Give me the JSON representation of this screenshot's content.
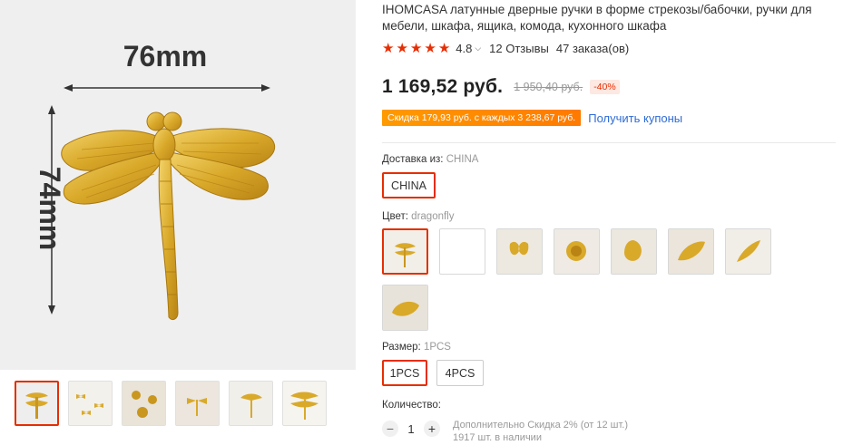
{
  "gallery": {
    "main_image": {
      "dimension_width": "76mm",
      "dimension_height": "74mm"
    },
    "thumbnails": [
      {
        "name": "thumb-1",
        "active": true
      },
      {
        "name": "thumb-2",
        "active": false
      },
      {
        "name": "thumb-3",
        "active": false
      },
      {
        "name": "thumb-4",
        "active": false
      },
      {
        "name": "thumb-5",
        "active": false
      },
      {
        "name": "thumb-6",
        "active": false
      }
    ]
  },
  "product": {
    "title": "IHOMCASA латунные дверные ручки в форме стрекозы/бабочки, ручки для мебели, шкафа, ящика, комода, кухонного шкафа",
    "rating": "4.8",
    "reviews": "12 Отзывы",
    "orders": "47 заказа(ов)",
    "price": "1 169,52 руб.",
    "old_price": "1 950,40 руб.",
    "discount": "-40%",
    "coupon_text": "Скидка 179,93 руб. с каждых 3 238,67 руб.",
    "coupon_link": "Получить купоны"
  },
  "shipping": {
    "label": "Доставка из:",
    "value": "CHINA",
    "option": "CHINA"
  },
  "color": {
    "label": "Цвет:",
    "value": "dragonfly"
  },
  "size": {
    "label": "Размер:",
    "value": "1PCS",
    "options": [
      "1PCS",
      "4PCS"
    ]
  },
  "quantity": {
    "label": "Количество:",
    "minus": "−",
    "value": "1",
    "plus": "+",
    "note_line1": "Дополнительно Скидка 2% (от 12 шт.)",
    "note_line2": "1917 шт. в наличии"
  },
  "colors": {
    "accent": "#e62e04",
    "link": "#2e6bd6",
    "coupon": "#ff8a00",
    "brass": "#d9a92a"
  }
}
